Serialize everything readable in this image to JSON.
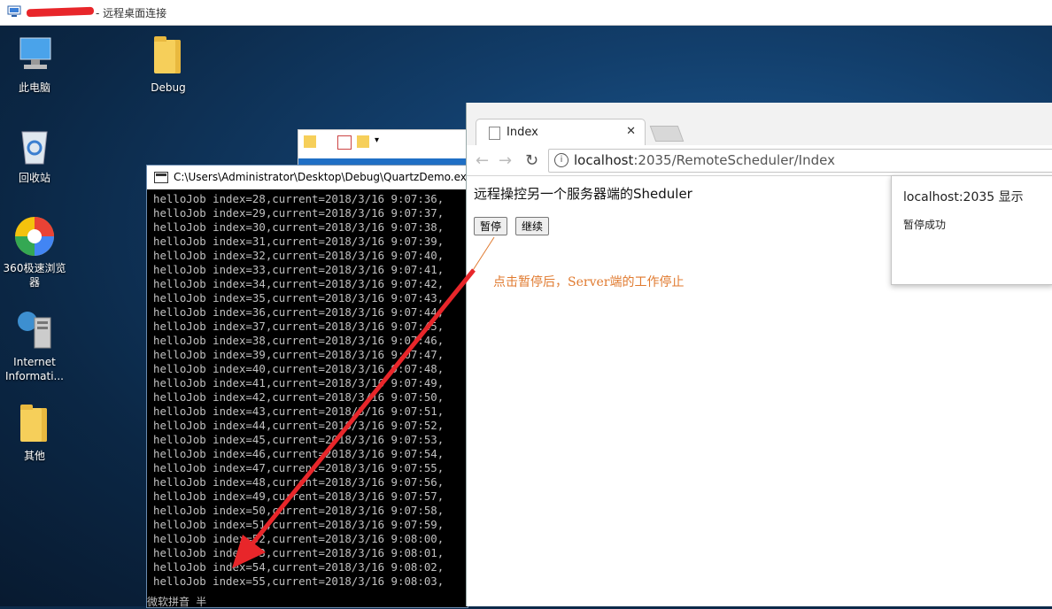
{
  "window": {
    "title": "- 远程桌面连接"
  },
  "desktop_icons": [
    {
      "name": "computer",
      "label": "此电脑"
    },
    {
      "name": "debug-folder",
      "label": "Debug"
    },
    {
      "name": "recycle-bin",
      "label": "回收站"
    },
    {
      "name": "browser-360",
      "label": "360极速浏览器"
    },
    {
      "name": "iis",
      "label": "Internet Informati..."
    },
    {
      "name": "other-folder",
      "label": "其他"
    }
  ],
  "console": {
    "title": "C:\\Users\\Administrator\\Desktop\\Debug\\QuartzDemo.exe",
    "lines": [
      "helloJob index=28,current=2018/3/16 9:07:36,",
      "helloJob index=29,current=2018/3/16 9:07:37,",
      "helloJob index=30,current=2018/3/16 9:07:38,",
      "helloJob index=31,current=2018/3/16 9:07:39,",
      "helloJob index=32,current=2018/3/16 9:07:40,",
      "helloJob index=33,current=2018/3/16 9:07:41,",
      "helloJob index=34,current=2018/3/16 9:07:42,",
      "helloJob index=35,current=2018/3/16 9:07:43,",
      "helloJob index=36,current=2018/3/16 9:07:44,",
      "helloJob index=37,current=2018/3/16 9:07:45,",
      "helloJob index=38,current=2018/3/16 9:07:46,",
      "helloJob index=39,current=2018/3/16 9:07:47,",
      "helloJob index=40,current=2018/3/16 9:07:48,",
      "helloJob index=41,current=2018/3/16 9:07:49,",
      "helloJob index=42,current=2018/3/16 9:07:50,",
      "helloJob index=43,current=2018/3/16 9:07:51,",
      "helloJob index=44,current=2018/3/16 9:07:52,",
      "helloJob index=45,current=2018/3/16 9:07:53,",
      "helloJob index=46,current=2018/3/16 9:07:54,",
      "helloJob index=47,current=2018/3/16 9:07:55,",
      "helloJob index=48,current=2018/3/16 9:07:56,",
      "helloJob index=49,current=2018/3/16 9:07:57,",
      "helloJob index=50,current=2018/3/16 9:07:58,",
      "helloJob index=51,current=2018/3/16 9:07:59,",
      "helloJob index=52,current=2018/3/16 9:08:00,",
      "helloJob index=53,current=2018/3/16 9:08:01,",
      "helloJob index=54,current=2018/3/16 9:08:02,",
      "helloJob index=55,current=2018/3/16 9:08:03,"
    ],
    "footer": "微软拼音 半"
  },
  "browser": {
    "tab_title": "Index",
    "url_host": "localhost",
    "url_rest": ":2035/RemoteScheduler/Index",
    "page": {
      "heading": "远程操控另一个服务器端的Sheduler",
      "pause_button": "暂停",
      "resume_button": "继续",
      "annotation": "点击暂停后，Server端的工作停止"
    },
    "alert": {
      "title": "localhost:2035 显示",
      "message": "暂停成功"
    }
  },
  "colors": {
    "annotation": "#e07a2f",
    "arrow": "#e8262a"
  }
}
